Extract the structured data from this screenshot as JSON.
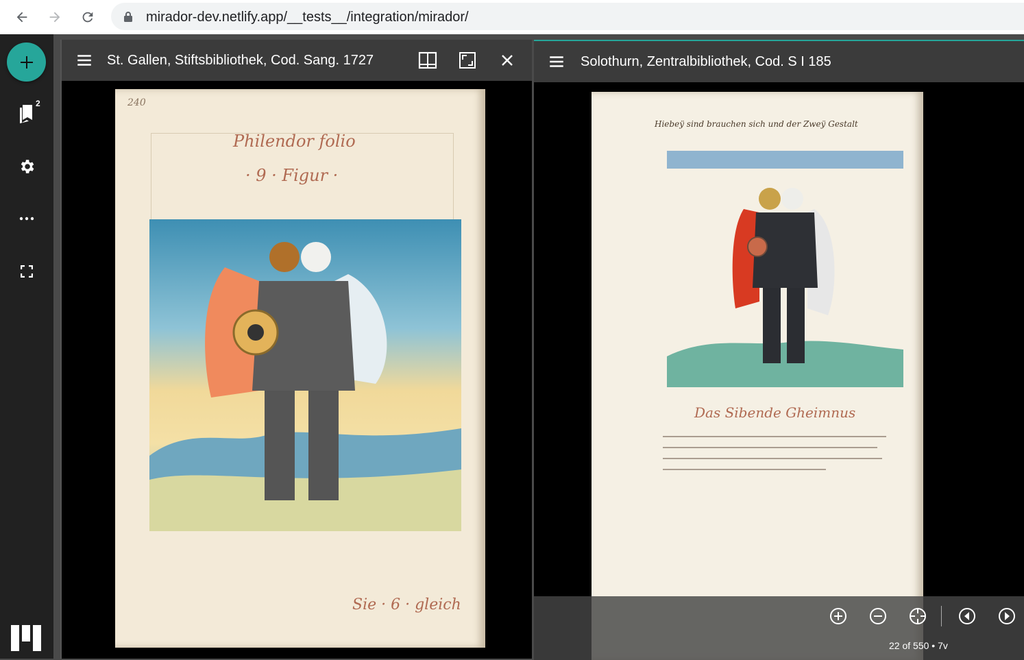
{
  "browser": {
    "url": "mirador-dev.netlify.app/__tests__/integration/mirador/",
    "back_icon": "arrow-left-icon",
    "forward_icon": "arrow-right-icon",
    "reload_icon": "reload-icon"
  },
  "rail": {
    "add_resource_icon": "plus-icon",
    "windows_badge": "2",
    "items": [
      "window-list-icon",
      "settings-icon",
      "more-icon",
      "fullscreen-icon"
    ]
  },
  "windows": [
    {
      "title": "St. Gallen, Stiftsbibliothek, Cod. Sang. 1727",
      "page_number": "240",
      "heading_line1": "Philendor folio",
      "heading_line2": "· 9 · Figur ·",
      "footer_script": "Sie · 6 · gleich"
    },
    {
      "title": "Solothurn, Zentralbibliothek, Cod. S I 185",
      "top_script": "Hiebeÿ sind brauchen sich und der Zweÿ Gestalt",
      "caption": "Das Sibende Gheimnus",
      "page_info": "22 of 550 • 7v"
    }
  ],
  "colors": {
    "accent": "#26a69a",
    "rail_bg": "#212121",
    "topbar_bg": "#3b3b3b"
  }
}
